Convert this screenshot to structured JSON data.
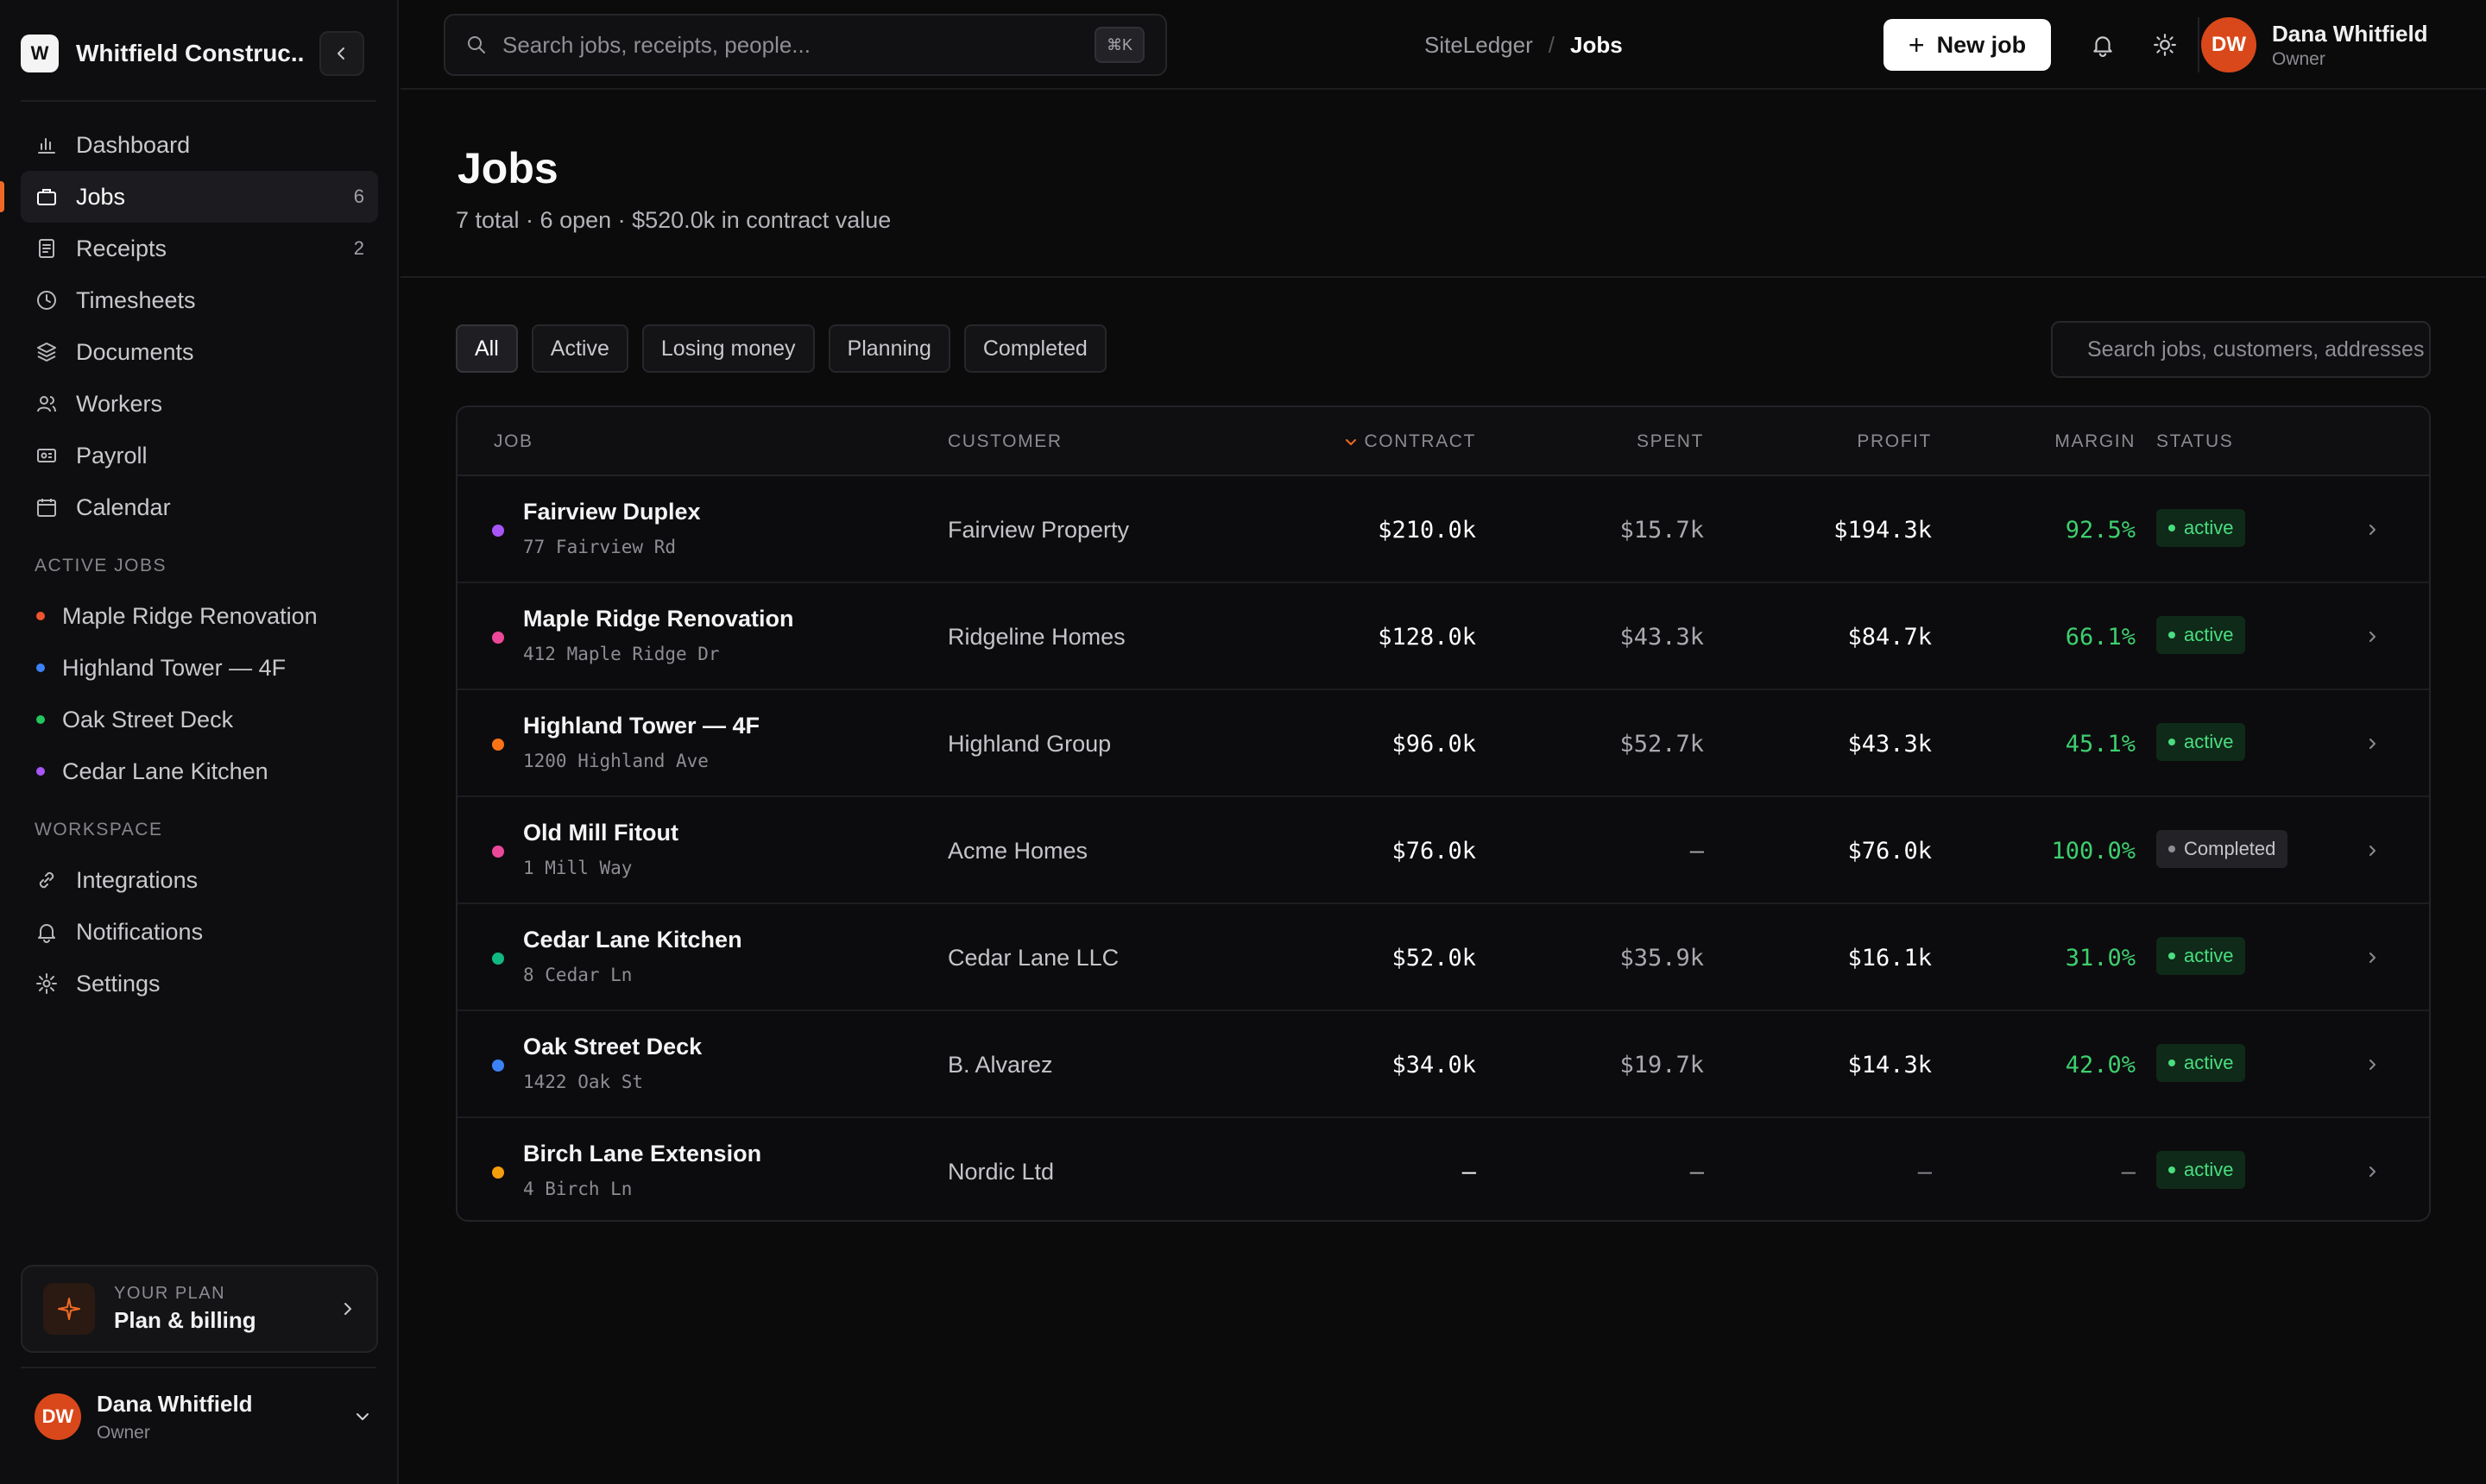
{
  "workspace": {
    "logo_letter": "W",
    "name": "Whitfield Construc..."
  },
  "nav": {
    "items": [
      {
        "label": "Dashboard",
        "icon": "bar-chart-icon",
        "count": ""
      },
      {
        "label": "Jobs",
        "icon": "briefcase-icon",
        "count": "6",
        "active": true
      },
      {
        "label": "Receipts",
        "icon": "receipt-icon",
        "count": "2"
      },
      {
        "label": "Timesheets",
        "icon": "clock-icon",
        "count": ""
      },
      {
        "label": "Documents",
        "icon": "layers-icon",
        "count": ""
      },
      {
        "label": "Workers",
        "icon": "users-icon",
        "count": ""
      },
      {
        "label": "Payroll",
        "icon": "payroll-icon",
        "count": ""
      },
      {
        "label": "Calendar",
        "icon": "calendar-icon",
        "count": ""
      }
    ],
    "active_jobs_label": "ACTIVE JOBS",
    "active_jobs": [
      {
        "label": "Maple Ridge Renovation",
        "color": "#f0542e"
      },
      {
        "label": "Highland Tower — 4F",
        "color": "#3b82f6"
      },
      {
        "label": "Oak Street Deck",
        "color": "#22c55e"
      },
      {
        "label": "Cedar Lane Kitchen",
        "color": "#a855f7"
      }
    ],
    "workspace_label": "WORKSPACE",
    "workspace_items": [
      {
        "label": "Integrations",
        "icon": "link-icon"
      },
      {
        "label": "Notifications",
        "icon": "bell-icon"
      },
      {
        "label": "Settings",
        "icon": "gear-icon"
      }
    ]
  },
  "plan": {
    "label": "YOUR PLAN",
    "title": "Plan & billing"
  },
  "user": {
    "initials": "DW",
    "name": "Dana Whitfield",
    "role": "Owner"
  },
  "topbar": {
    "search_placeholder": "Search jobs, receipts, people...",
    "shortcut": "⌘K",
    "breadcrumb": [
      "SiteLedger",
      "/",
      "Jobs"
    ],
    "new_job_label": "New job"
  },
  "page": {
    "title": "Jobs",
    "subtitle": "7 total · 6 open · $520.0k in contract value"
  },
  "filters": [
    "All",
    "Active",
    "Losing money",
    "Planning",
    "Completed"
  ],
  "table_search_placeholder": "Search jobs, customers, addresses",
  "table": {
    "columns": [
      "JOB",
      "CUSTOMER",
      "CONTRACT",
      "SPENT",
      "PROFIT",
      "MARGIN",
      "STATUS"
    ],
    "rows": [
      {
        "name": "Fairview Duplex",
        "address": "77 Fairview Rd",
        "color": "#a855f7",
        "customer": "Fairview Property",
        "contract": "$210.0k",
        "spent": "$15.7k",
        "profit": "$194.3k",
        "margin": "92.5%",
        "status": "active"
      },
      {
        "name": "Maple Ridge Renovation",
        "address": "412 Maple Ridge Dr",
        "color": "#ec4899",
        "customer": "Ridgeline Homes",
        "contract": "$128.0k",
        "spent": "$43.3k",
        "profit": "$84.7k",
        "margin": "66.1%",
        "status": "active"
      },
      {
        "name": "Highland Tower — 4F",
        "address": "1200 Highland Ave",
        "color": "#f97316",
        "customer": "Highland Group",
        "contract": "$96.0k",
        "spent": "$52.7k",
        "profit": "$43.3k",
        "margin": "45.1%",
        "status": "active"
      },
      {
        "name": "Old Mill Fitout",
        "address": "1 Mill Way",
        "color": "#ec4899",
        "customer": "Acme Homes",
        "contract": "$76.0k",
        "spent": "–",
        "profit": "$76.0k",
        "margin": "100.0%",
        "status": "Completed"
      },
      {
        "name": "Cedar Lane Kitchen",
        "address": "8 Cedar Ln",
        "color": "#10b981",
        "customer": "Cedar Lane LLC",
        "contract": "$52.0k",
        "spent": "$35.9k",
        "profit": "$16.1k",
        "margin": "31.0%",
        "status": "active"
      },
      {
        "name": "Oak Street Deck",
        "address": "1422 Oak St",
        "color": "#3b82f6",
        "customer": "B. Alvarez",
        "contract": "$34.0k",
        "spent": "$19.7k",
        "profit": "$14.3k",
        "margin": "42.0%",
        "status": "active"
      },
      {
        "name": "Birch Lane Extension",
        "address": "4 Birch Ln",
        "color": "#f59e0b",
        "customer": "Nordic Ltd",
        "contract": "–",
        "spent": "–",
        "profit": "–",
        "margin": "–",
        "status": "active"
      }
    ]
  }
}
